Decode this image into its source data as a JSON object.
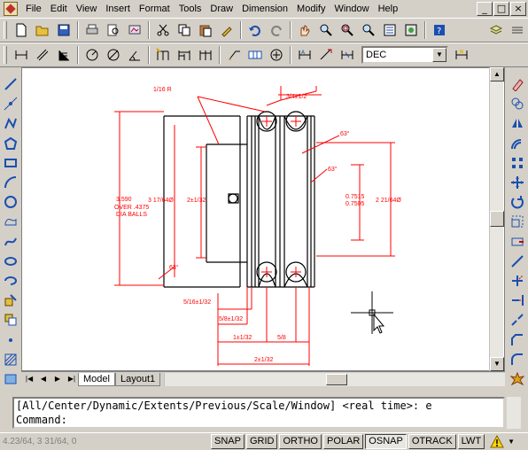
{
  "menu": {
    "items": [
      "File",
      "Edit",
      "View",
      "Insert",
      "Format",
      "Tools",
      "Draw",
      "Dimension",
      "Modify",
      "Window",
      "Help"
    ],
    "window_controls": [
      "_",
      "□",
      "×"
    ]
  },
  "dim_toolbar": {
    "dimstyle_value": "DEC"
  },
  "drawing": {
    "labels": {
      "radius": "1/16 R",
      "top_width": "3/4±1/2",
      "diam_left": "3.590",
      "over_balls_1": "OVER .4375",
      "over_balls_2": "DIA BALLS",
      "d1": "3 17/64Ø",
      "d2": "2±1/32",
      "bore_1": "0.7515",
      "bore_2": "0.7505",
      "d3": "2 21/64Ø",
      "angle_a": "63°",
      "angle_b": "63°",
      "angle_c": "63°",
      "dim_1": "5/16±1/32",
      "dim_2": "5/8±1/32",
      "dim_3": "1±1/32",
      "dim_4": "5/8",
      "dim_5": "2±1/32"
    }
  },
  "tabs": {
    "items": [
      "Model",
      "Layout1"
    ],
    "active": "Model",
    "nav": [
      "|◀",
      "◀",
      "▶",
      "▶|"
    ]
  },
  "command": {
    "line1": "[All/Center/Dynamic/Extents/Previous/Scale/Window] <real time>: e",
    "line2": "Command:"
  },
  "status": {
    "coords": "4.23/64, 3 31/64, 0",
    "toggles": [
      {
        "label": "SNAP",
        "on": false
      },
      {
        "label": "GRID",
        "on": false
      },
      {
        "label": "ORTHO",
        "on": false
      },
      {
        "label": "POLAR",
        "on": false
      },
      {
        "label": "OSNAP",
        "on": true
      },
      {
        "label": "OTRACK",
        "on": false
      },
      {
        "label": "LWT",
        "on": false
      }
    ]
  },
  "colors": {
    "drawing_red": "#ff0000",
    "drawing_black": "#000000",
    "icon_blue": "#1a4fb0"
  }
}
